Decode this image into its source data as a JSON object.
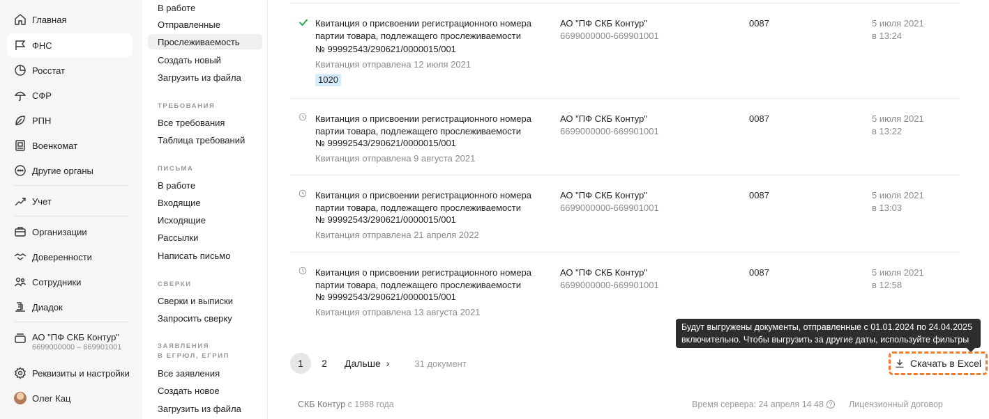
{
  "nav": {
    "items": [
      {
        "label": "Главная",
        "icon": "home-icon"
      },
      {
        "label": "ФНС",
        "icon": "flag-icon"
      },
      {
        "label": "Росстат",
        "icon": "pie-chart-icon"
      },
      {
        "label": "СФР",
        "icon": "umbrella-icon"
      },
      {
        "label": "РПН",
        "icon": "leaf-icon"
      },
      {
        "label": "Военкомат",
        "icon": "badge-icon"
      },
      {
        "label": "Другие органы",
        "icon": "more-circle-icon"
      },
      {
        "label": "Учет",
        "icon": "chart-growth-icon"
      },
      {
        "label": "Организации",
        "icon": "briefcase-icon"
      },
      {
        "label": "Доверенности",
        "icon": "handshake-icon"
      },
      {
        "label": "Сотрудники",
        "icon": "people-icon"
      },
      {
        "label": "Диадок",
        "icon": "diadoc-icon"
      }
    ],
    "org": {
      "name": "АО \"ПФ СКБ Контур\"",
      "inn": "6699000000 – 669901001"
    },
    "settings_label": "Реквизиты и настройки",
    "user_name": "Олег Кац"
  },
  "subnav": {
    "top_items": [
      "В работе",
      "Отправленные",
      "Прослеживаемость",
      "Создать новый",
      "Загрузить из файла"
    ],
    "sections": [
      {
        "heading": "ТРЕБОВАНИЯ",
        "items": [
          "Все требования",
          "Таблица требований"
        ]
      },
      {
        "heading": "ПИСЬМА",
        "items": [
          "В работе",
          "Входящие",
          "Исходящие",
          "Рассылки",
          "Написать письмо"
        ]
      },
      {
        "heading": "СВЕРКИ",
        "items": [
          "Сверки и выписки",
          "Запросить сверку"
        ]
      },
      {
        "heading_line1": "ЗАЯВЛЕНИЯ",
        "heading_line2": "В ЕГРЮЛ, ЕГРИП",
        "items": [
          "Все заявления",
          "Создать новое",
          "Загрузить из файла"
        ]
      }
    ]
  },
  "rows": [
    {
      "status": "check",
      "title_line1": "Квитанция о присвоении регистрационного номера",
      "title_line2": "партии товара, подлежащего прослеживаемости",
      "number": "№ 99992543/290621/0000015/001",
      "sent": "Квитанция отправлена 12 июля 2021",
      "code": "1020",
      "org": "АО \"ПФ СКБ Контур\"",
      "inn": "6699000000-669901001",
      "ifns": "0087",
      "date": "5 июля 2021",
      "time": "в 13:24"
    },
    {
      "status": "clock",
      "title_line1": "Квитанция о присвоении регистрационного номера",
      "title_line2": "партии товара, подлежащего прослеживаемости",
      "number": "№ 99992543/290621/0000015/001",
      "sent": "Квитанция отправлена 9 августа 2021",
      "org": "АО \"ПФ СКБ Контур\"",
      "inn": "6699000000-669901001",
      "ifns": "0087",
      "date": "5 июля 2021",
      "time": "в 13:22"
    },
    {
      "status": "clock",
      "title_line1": "Квитанция о присвоении регистрационного номера",
      "title_line2": "партии товара, подлежащего прослеживаемости",
      "number": "№ 99992543/290621/0000015/001",
      "sent": "Квитанция отправлена 21 апреля 2022",
      "org": "АО \"ПФ СКБ Контур\"",
      "inn": "6699000000-669901001",
      "ifns": "0087",
      "date": "5 июля 2021",
      "time": "в 13:03"
    },
    {
      "status": "clock",
      "title_line1": "Квитанция о присвоении регистрационного номера",
      "title_line2": "партии товара, подлежащего прослеживаемости",
      "number": "№ 99992543/290621/0000015/001",
      "sent": "Квитанция отправлена 13 августа 2021",
      "org": "АО \"ПФ СКБ Контур\"",
      "inn": "6699000000-669901001",
      "ifns": "0087",
      "date": "5 июля 2021",
      "time": "в 12:58"
    }
  ],
  "pager": {
    "page1": "1",
    "page2": "2",
    "next_label": "Дальше",
    "count": "31 документ"
  },
  "tooltip": {
    "line1": "Будут выгружены документы, отправленные с 01.01.2024 по 24.04.2025",
    "line2": "включительно. Чтобы выгрузить за другие даты, используйте фильтры"
  },
  "excel_label": "Скачать в Excel",
  "footer": {
    "brand": "СКБ Контур",
    "since": " с 1988 года",
    "server_time": "Время сервера: 24 апреля 14 48",
    "license": "Лицензионный договор"
  },
  "colors": {
    "accent_highlight": "#f07a2e",
    "check": "#2ea44f",
    "code_bg": "#d7ecfb"
  }
}
